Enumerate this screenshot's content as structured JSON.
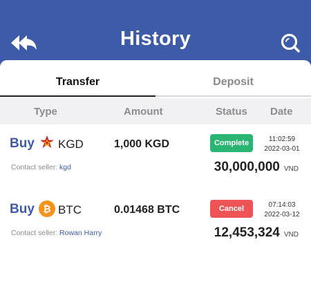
{
  "header": {
    "title": "History",
    "back_icon": "double-back-arrow-icon",
    "search_icon": "search-icon",
    "bg_color": "#3e5ba9"
  },
  "tabs": [
    {
      "label": "Transfer",
      "active": true
    },
    {
      "label": "Deposit",
      "active": false
    }
  ],
  "columns": {
    "type": "Type",
    "amount": "Amount",
    "status": "Status",
    "date": "Date"
  },
  "rows": [
    {
      "action": "Buy",
      "coin_icon": "kgd-coin-icon",
      "coin": "KGD",
      "amount": "1,000 KGD",
      "status": "Complete",
      "status_color": "#2bb573",
      "time": "11:02:59",
      "date": "2022-03-01",
      "seller_label": "Contact seller:",
      "seller_name": "kgd",
      "total": "30,000,000",
      "currency": "VND"
    },
    {
      "action": "Buy",
      "coin_icon": "bitcoin-icon",
      "coin": "BTC",
      "amount": "0.01468 BTC",
      "status": "Cancel",
      "status_color": "#ee5355",
      "time": "07:14:03",
      "date": "2022-03-12",
      "seller_label": "Contact seller:",
      "seller_name": "Rowan Harry",
      "total": "12,453,324",
      "currency": "VND"
    }
  ]
}
